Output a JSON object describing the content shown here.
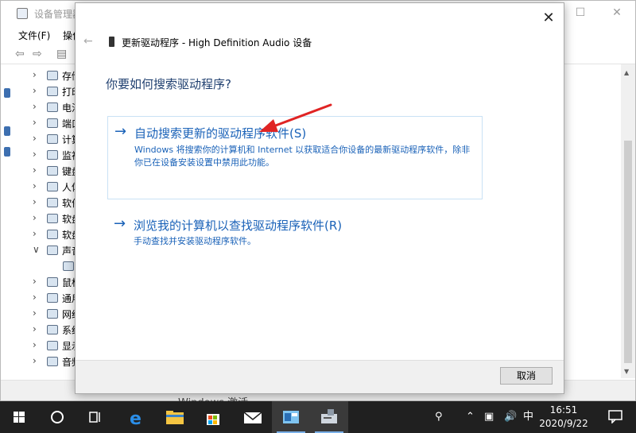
{
  "device_manager": {
    "title": "设备管理器",
    "menu": [
      "文件(F)",
      "操作"
    ],
    "tree": [
      {
        "label": "存储",
        "expanded": false
      },
      {
        "label": "打印",
        "expanded": false
      },
      {
        "label": "电池",
        "expanded": false
      },
      {
        "label": "端口",
        "expanded": false
      },
      {
        "label": "计算",
        "expanded": false
      },
      {
        "label": "监视",
        "expanded": false
      },
      {
        "label": "键盘",
        "expanded": false
      },
      {
        "label": "人体",
        "expanded": false
      },
      {
        "label": "软件",
        "expanded": false
      },
      {
        "label": "软盘",
        "expanded": false
      },
      {
        "label": "软盘",
        "expanded": false
      },
      {
        "label": "声音",
        "expanded": true
      },
      {
        "label": "",
        "expanded": false,
        "child": true
      },
      {
        "label": "鼠标",
        "expanded": false
      },
      {
        "label": "通用",
        "expanded": false
      },
      {
        "label": "网络",
        "expanded": false
      },
      {
        "label": "系统",
        "expanded": false
      },
      {
        "label": "显示",
        "expanded": false
      },
      {
        "label": "音频",
        "expanded": false
      }
    ],
    "watermark": "Windows 激活"
  },
  "dialog": {
    "title": "更新驱动程序 - High Definition Audio 设备",
    "heading": "你要如何搜索驱动程序?",
    "options": [
      {
        "title": "自动搜索更新的驱动程序软件(S)",
        "description": "Windows 将搜索你的计算机和 Internet 以获取适合你设备的最新驱动程序软件，除非你已在设备安装设置中禁用此功能。"
      },
      {
        "title": "浏览我的计算机以查找驱动程序软件(R)",
        "description": "手动查找并安装驱动程序软件。"
      }
    ],
    "cancel_label": "取消",
    "close_label": "✕",
    "back_label": "←"
  },
  "taskbar": {
    "time": "16:51",
    "date": "2020/9/22",
    "ime": "中",
    "items": [
      "start",
      "search",
      "task-view",
      "edge",
      "file-explorer",
      "store",
      "mail",
      "app",
      "device-manager"
    ]
  },
  "colors": {
    "link_blue": "#1a62b8",
    "annotation_red": "#e02424",
    "taskbar": "#202020"
  }
}
